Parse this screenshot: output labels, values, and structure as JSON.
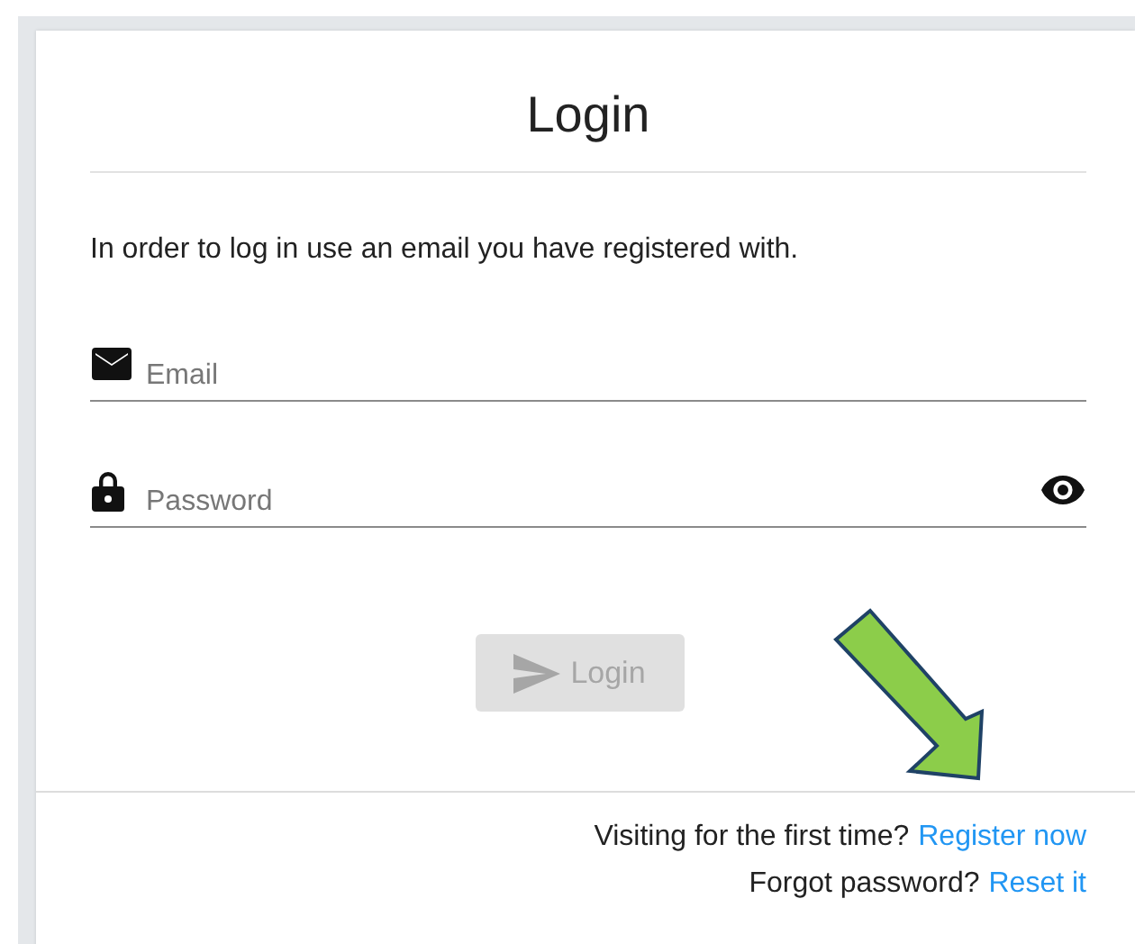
{
  "title": "Login",
  "intro": "In order to log in use an email you have registered with.",
  "fields": [
    {
      "kind": "email",
      "placeholder": "Email"
    },
    {
      "kind": "password",
      "placeholder": "Password"
    }
  ],
  "login_button": {
    "label": "Login",
    "disabled": true
  },
  "footer": [
    {
      "text": "Visiting for the first time?",
      "link": "Register now"
    },
    {
      "text": "Forgot password?",
      "link": "Reset it"
    }
  ]
}
